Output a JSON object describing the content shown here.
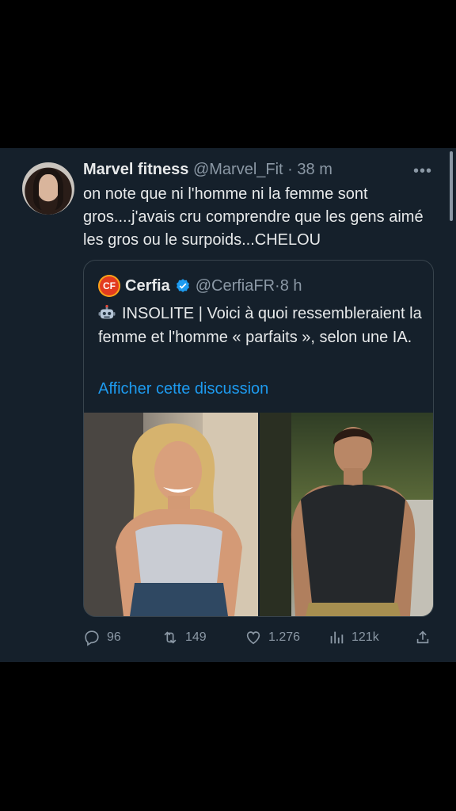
{
  "tweet": {
    "author_name": "Marvel fitness",
    "handle": "@Marvel_Fit",
    "separator": "·",
    "time": "38 m",
    "more": "•••",
    "text": "on note que ni l'homme ni la femme sont gros....j'avais cru comprendre que les gens aimé les gros ou le surpoids...CHELOU"
  },
  "quote": {
    "logo": "CF",
    "author_name": "Cerfia",
    "handle": "@CerfiaFR",
    "separator": "·",
    "time": "8 h",
    "text": "INSOLITE | Voici à quoi ressembleraient la femme et l'homme « parfaits », selon une IA.",
    "show_thread": "Afficher cette discussion"
  },
  "actions": {
    "replies": "96",
    "retweets": "149",
    "likes": "1.276",
    "views": "121k"
  },
  "colors": {
    "background": "#15202b",
    "accent": "#1d9bf0",
    "muted": "#8b98a5"
  },
  "icons": [
    "more-icon",
    "verified-icon",
    "robot-icon",
    "reply-icon",
    "retweet-icon",
    "like-icon",
    "views-icon",
    "share-icon"
  ]
}
